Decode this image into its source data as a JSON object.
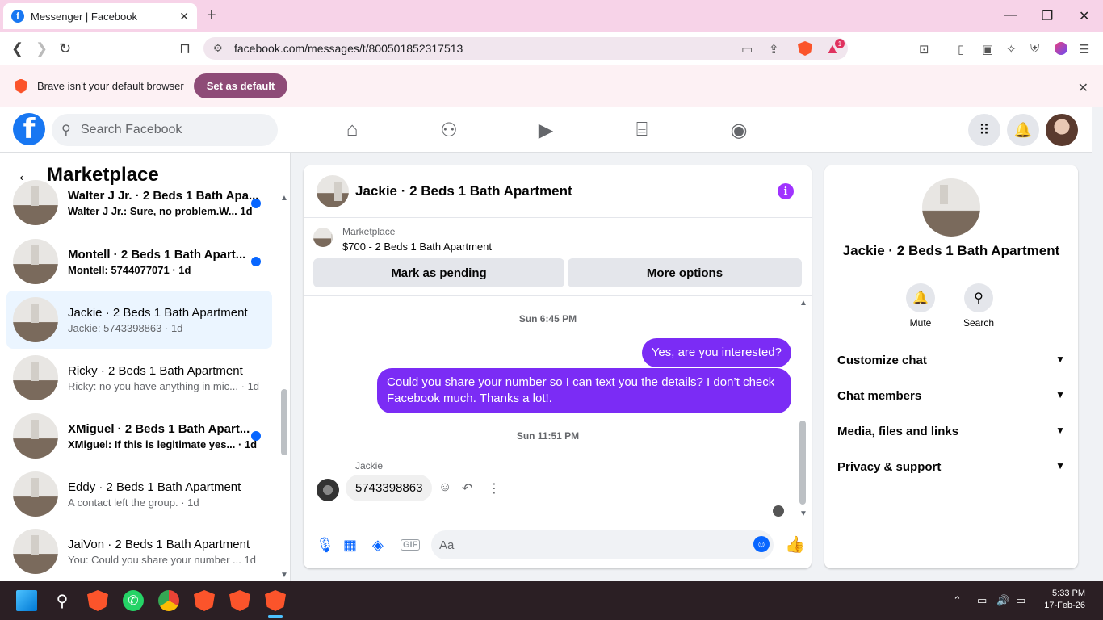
{
  "browser": {
    "tab_title": "Messenger | Facebook",
    "url": "facebook.com/messages/t/800501852317513",
    "notification_count": "1",
    "infobar_text": "Brave isn't your default browser",
    "set_default_label": "Set as default"
  },
  "facebook": {
    "search_placeholder": "Search Facebook"
  },
  "sidebar": {
    "title": "Marketplace",
    "conversations": [
      {
        "name": "Walter J Jr. · 2 Beds 1 Bath Apa...",
        "snippet": "Walter J Jr.: Sure, no problem.W...",
        "time": "1d",
        "unread": true
      },
      {
        "name": "Montell · 2 Beds 1 Bath Apart...",
        "snippet": "Montell: 5744077071",
        "time": "1d",
        "unread": true
      },
      {
        "name": "Jackie · 2 Beds 1 Bath Apartment",
        "snippet": "Jackie: 5743398863",
        "time": "1d",
        "unread": false
      },
      {
        "name": "Ricky · 2 Beds 1 Bath Apartment",
        "snippet": "Ricky: no you have anything in mic...",
        "time": "1d",
        "unread": false
      },
      {
        "name": "XMiguel · 2 Beds 1 Bath Apart...",
        "snippet": "XMiguel: If this is legitimate yes...",
        "time": "1d",
        "unread": true
      },
      {
        "name": "Eddy · 2 Beds 1 Bath Apartment",
        "snippet": "A contact left the group.",
        "time": "1d",
        "unread": false
      },
      {
        "name": "JaiVon · 2 Beds 1 Bath Apartment",
        "snippet": "You: Could you share your number ...",
        "time": "1d",
        "unread": false
      }
    ]
  },
  "chat": {
    "title": "Jackie · 2 Beds 1 Bath Apartment",
    "listing_source": "Marketplace",
    "listing_title": "$700 - 2 Beds 1 Bath Apartment",
    "mark_pending_label": "Mark as pending",
    "more_options_label": "More options",
    "timestamp1": "Sun 6:45 PM",
    "msg1": "Yes, are you interested?",
    "msg2": "Could you share your number so I can text you the details? I don’t check Facebook much. Thanks a lot!.",
    "timestamp2": "Sun 11:51 PM",
    "sender": "Jackie",
    "msg3": "5743398863",
    "input_placeholder": "Aa",
    "gif_label": "GIF"
  },
  "details": {
    "title": "Jackie · 2 Beds 1 Bath Apartment",
    "mute_label": "Mute",
    "search_label": "Search",
    "sections": [
      "Customize chat",
      "Chat members",
      "Media, files and links",
      "Privacy & support"
    ]
  },
  "taskbar": {
    "time": "5:33 PM",
    "date": "17-Feb-26"
  }
}
